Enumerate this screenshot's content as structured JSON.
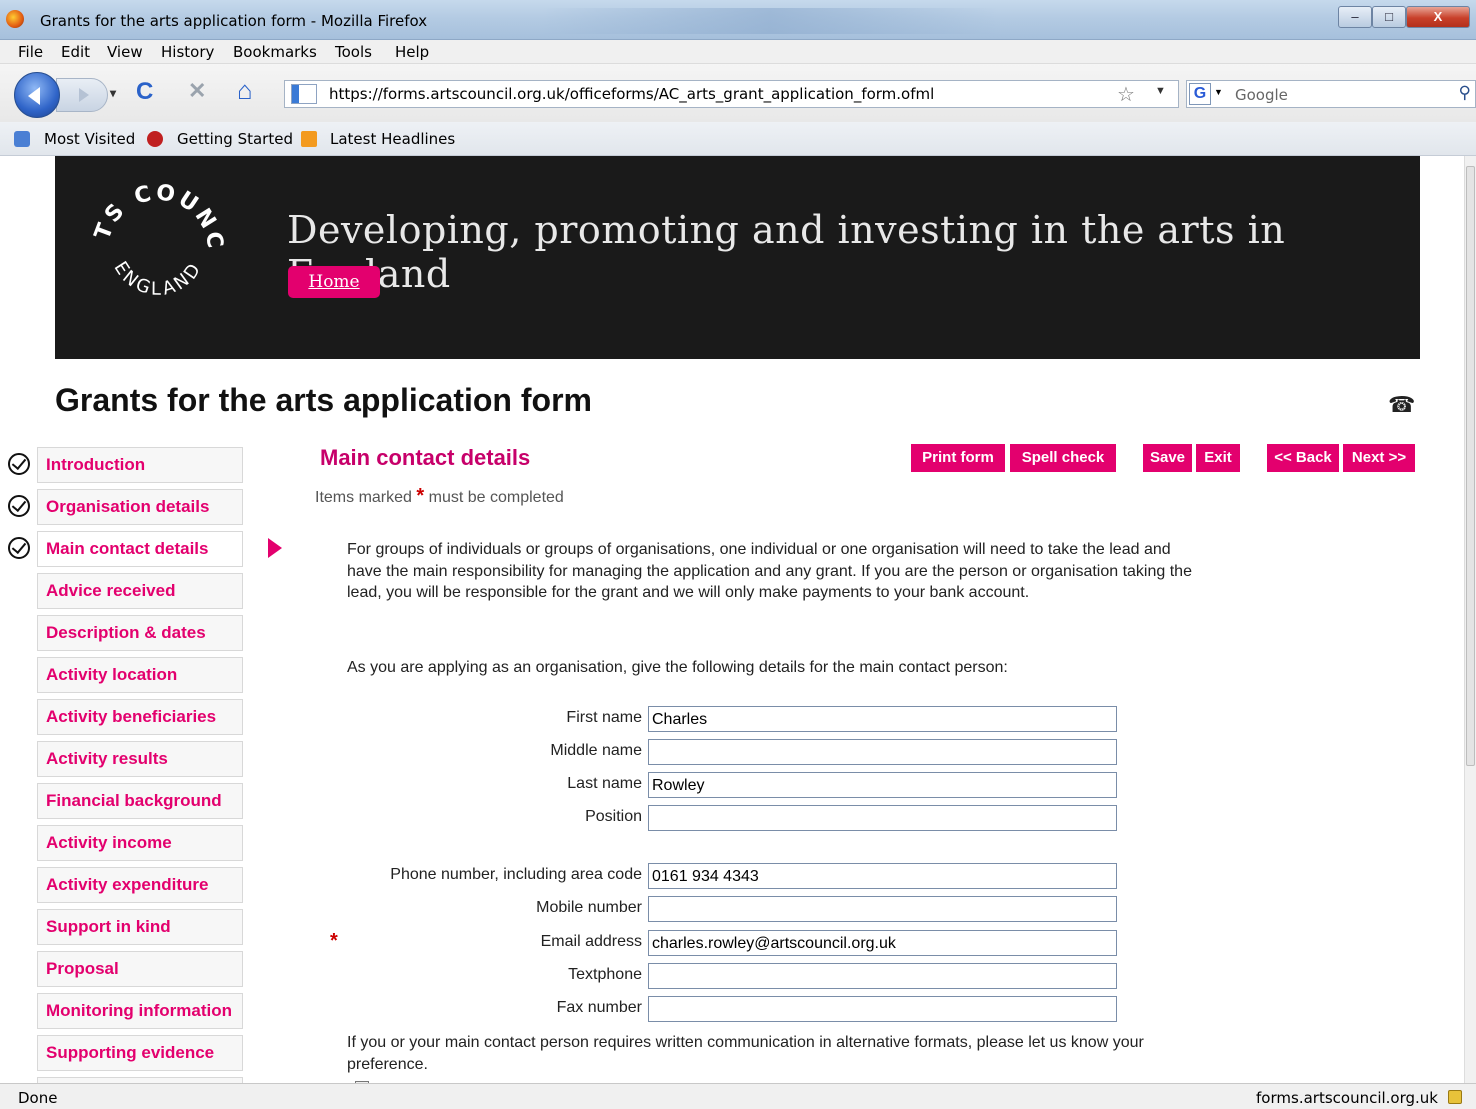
{
  "window": {
    "title": "Grants for the arts application form - Mozilla Firefox",
    "minimize": "–",
    "maximize": "□",
    "close": "X"
  },
  "menu": [
    "File",
    "Edit",
    "View",
    "History",
    "Bookmarks",
    "Tools",
    "Help"
  ],
  "nav": {
    "url": "https://forms.artscouncil.org.uk/officeforms/AC_arts_grant_application_form.ofml",
    "search_placeholder": "Google",
    "reload": "C",
    "stop": "✕",
    "home": "⌂"
  },
  "bookmarks": [
    "Most Visited",
    "Getting Started",
    "Latest Headlines"
  ],
  "banner": {
    "logo_text_top": "ARTS COUNCIL",
    "logo_text_bottom": "ENGLAND",
    "tagline": "Developing, promoting and investing in the arts in England",
    "home": "Home",
    "brand_color": "#e3006e"
  },
  "page_title": "Grants for the arts application form",
  "sidebar": [
    {
      "label": "Introduction",
      "done": true
    },
    {
      "label": "Organisation details",
      "done": true
    },
    {
      "label": "Main contact details",
      "done": true,
      "current": true
    },
    {
      "label": "Advice received",
      "done": false
    },
    {
      "label": "Description & dates",
      "done": false
    },
    {
      "label": "Activity location",
      "done": false
    },
    {
      "label": "Activity beneficiaries",
      "done": false
    },
    {
      "label": "Activity results",
      "done": false
    },
    {
      "label": "Financial background",
      "done": false
    },
    {
      "label": "Activity income",
      "done": false
    },
    {
      "label": "Activity expenditure",
      "done": false
    },
    {
      "label": "Support in kind",
      "done": false
    },
    {
      "label": "Proposal",
      "done": false
    },
    {
      "label": "Monitoring information",
      "done": false
    },
    {
      "label": "Supporting evidence",
      "done": false
    }
  ],
  "main": {
    "section_title": "Main contact details",
    "buttons": {
      "print": "Print form",
      "spell": "Spell check",
      "save": "Save",
      "exit": "Exit",
      "back": "<< Back",
      "next": "Next >>"
    },
    "required_prefix": "Items marked",
    "required_star": "*",
    "required_suffix": "must be completed",
    "intro": "For groups of individuals or groups of organisations, one individual or one organisation will need to take the lead and have the main responsibility for managing the application and any grant. If you are the person or organisation taking the lead, you will be responsible for the grant and we will only make payments to your bank account.",
    "instruction": "As you are applying as an organisation, give the following details for the main contact person:",
    "fields": {
      "first_name": {
        "label": "First name",
        "value": "Charles"
      },
      "middle_name": {
        "label": "Middle name",
        "value": ""
      },
      "last_name": {
        "label": "Last name",
        "value": "Rowley"
      },
      "position": {
        "label": "Position",
        "value": ""
      },
      "phone": {
        "label": "Phone number, including area code",
        "value": "0161 934 4343"
      },
      "mobile": {
        "label": "Mobile number",
        "value": ""
      },
      "email": {
        "label": "Email address",
        "value": "charles.rowley@artscouncil.org.uk",
        "required": true
      },
      "textphone": {
        "label": "Textphone",
        "value": ""
      },
      "fax": {
        "label": "Fax number",
        "value": ""
      }
    },
    "alt_formats": "If you or your main contact person requires written communication in alternative formats, please let us know your preference."
  },
  "status": {
    "left": "Done",
    "right": "forms.artscouncil.org.uk"
  }
}
